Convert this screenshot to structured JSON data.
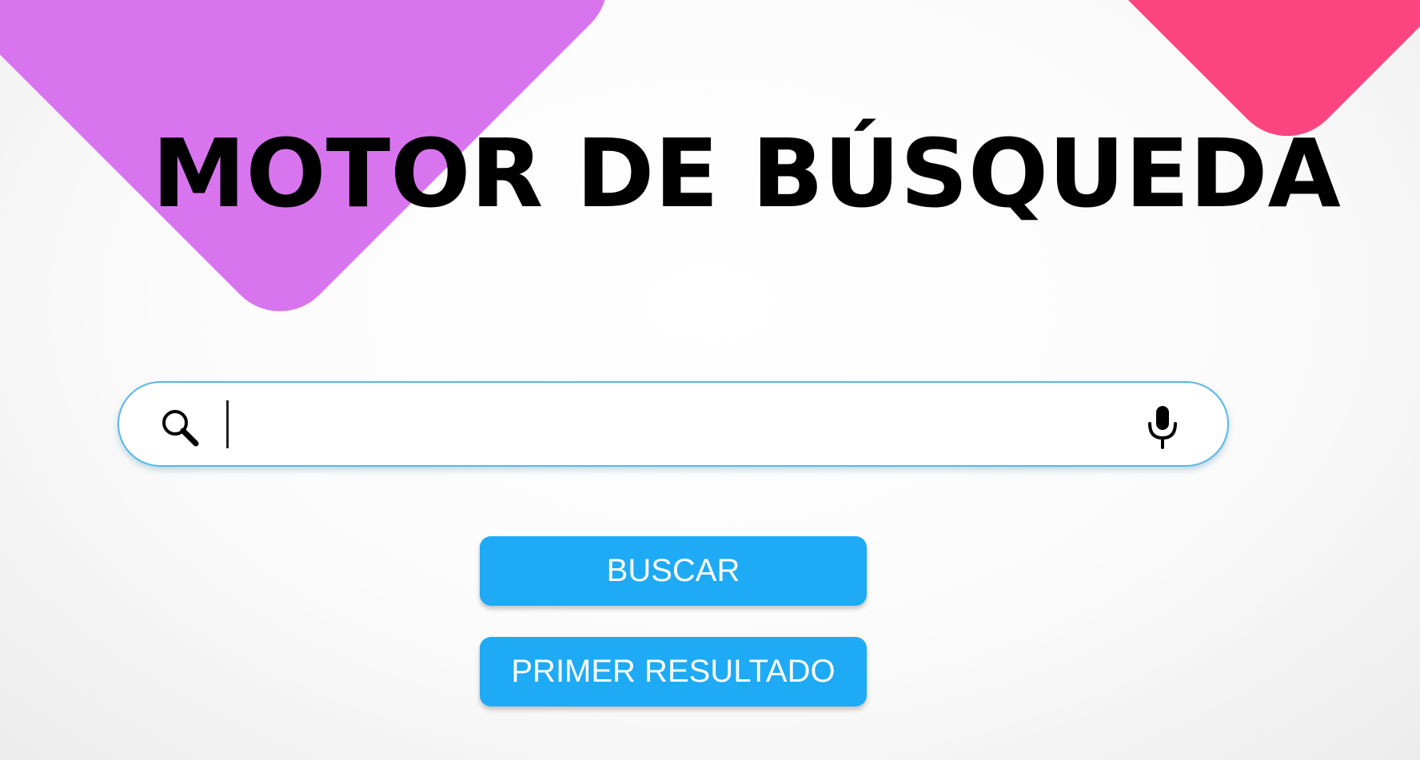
{
  "page": {
    "title": "MOTOR DE BÚSQUEDA"
  },
  "search": {
    "value": "",
    "placeholder": "",
    "search_icon": "search-icon",
    "mic_icon": "microphone-icon"
  },
  "buttons": {
    "search_label": "BUSCAR",
    "first_result_label": "PRIMER RESULTADO"
  },
  "colors": {
    "decor_purple": "#d875ee",
    "decor_pink": "#fc4480",
    "button_blue": "#1eaaf5",
    "search_border": "#58b8e6"
  }
}
